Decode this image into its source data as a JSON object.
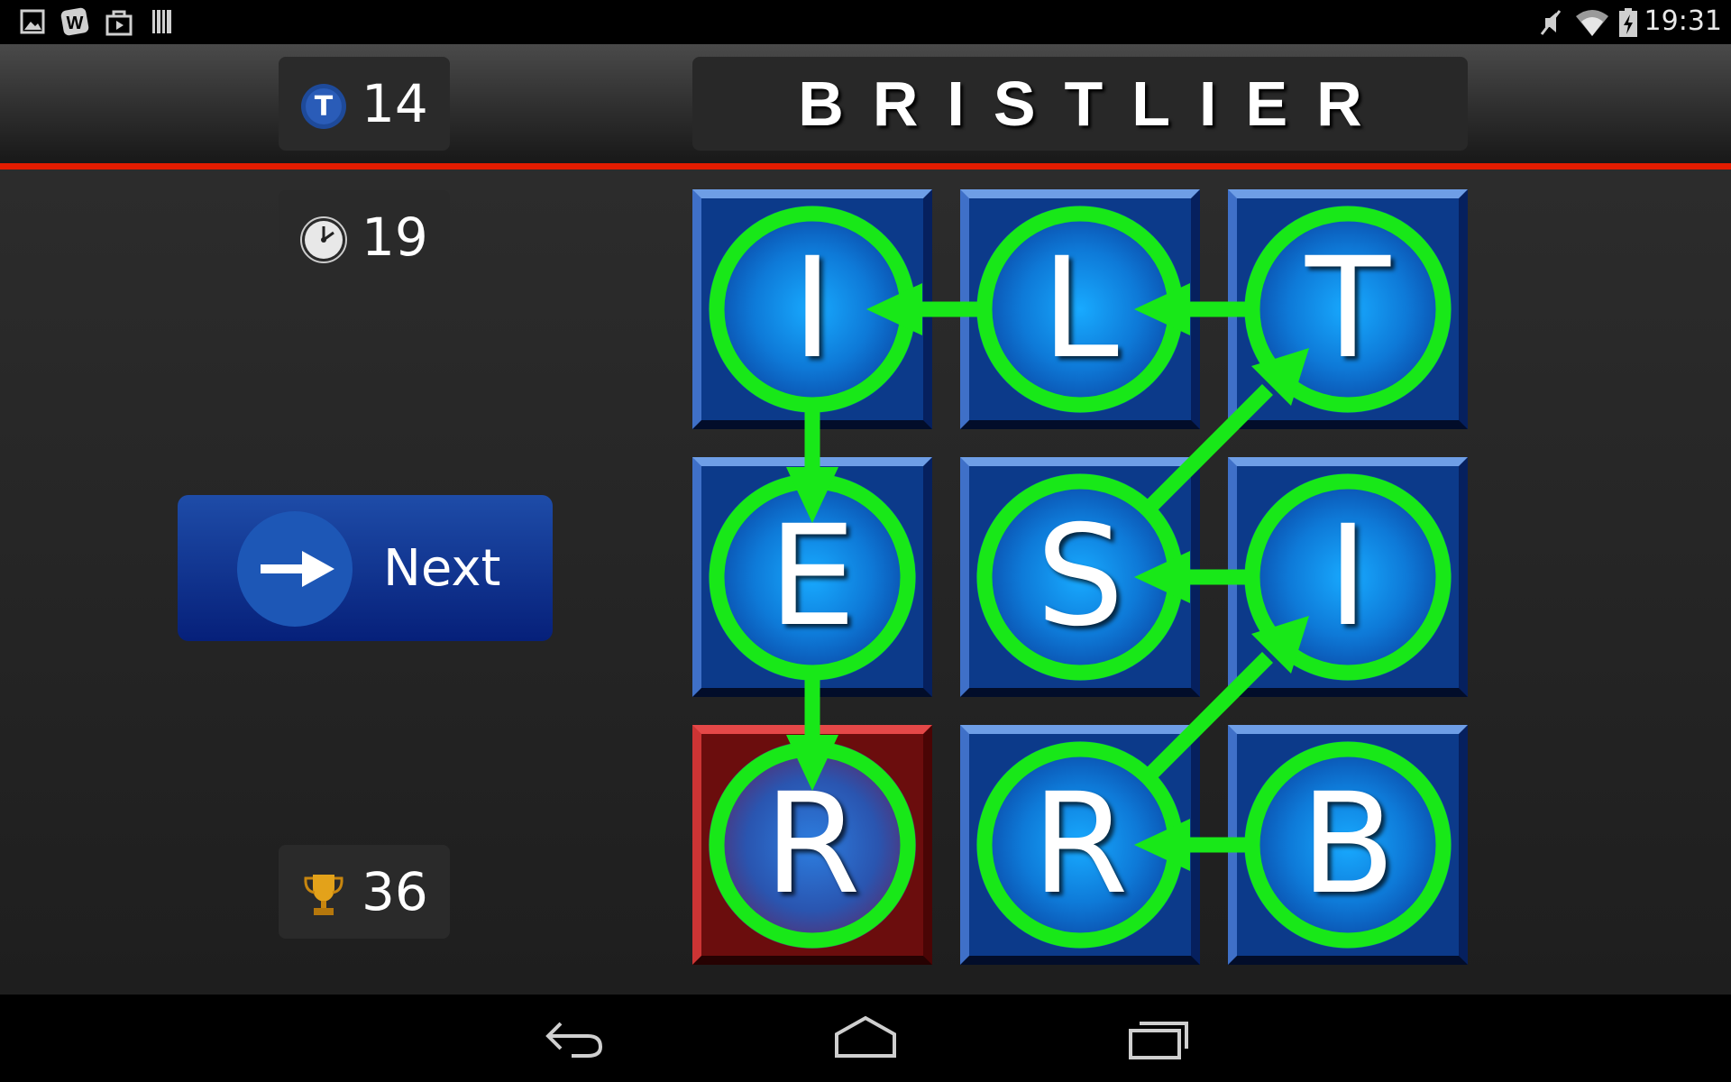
{
  "status_bar": {
    "left_icons": [
      "gallery-icon",
      "word-app-icon",
      "store-icon",
      "barcode-icon"
    ],
    "right_icons": [
      "mute-icon",
      "wifi-icon",
      "battery-charging-icon"
    ],
    "time": "19:31"
  },
  "game": {
    "turns": {
      "icon": "turns-t-icon",
      "value": "14"
    },
    "timer": {
      "icon": "clock-icon",
      "value": "19"
    },
    "score": {
      "icon": "trophy-icon",
      "value": "36"
    },
    "word": "BRISTLIER",
    "next_button": {
      "icon": "arrow-right-icon",
      "label": "Next"
    },
    "grid": {
      "rows": [
        [
          "I",
          "L",
          "T"
        ],
        [
          "E",
          "S",
          "I"
        ],
        [
          "R",
          "R",
          "B"
        ]
      ],
      "selected_tile": {
        "row": 2,
        "col": 0
      },
      "path": [
        [
          2,
          2
        ],
        [
          2,
          1
        ],
        [
          1,
          2
        ],
        [
          1,
          1
        ],
        [
          0,
          2
        ],
        [
          0,
          1
        ],
        [
          0,
          0
        ],
        [
          1,
          0
        ],
        [
          2,
          0
        ]
      ]
    }
  },
  "colors": {
    "accent_red": "#e21c00",
    "path_green": "#18e818",
    "tile_blue": "#0c3a8a",
    "tile_selected_red": "#6b0d0d"
  },
  "nav_bar": {
    "icons": [
      "back-icon",
      "home-icon",
      "recent-apps-icon"
    ]
  }
}
